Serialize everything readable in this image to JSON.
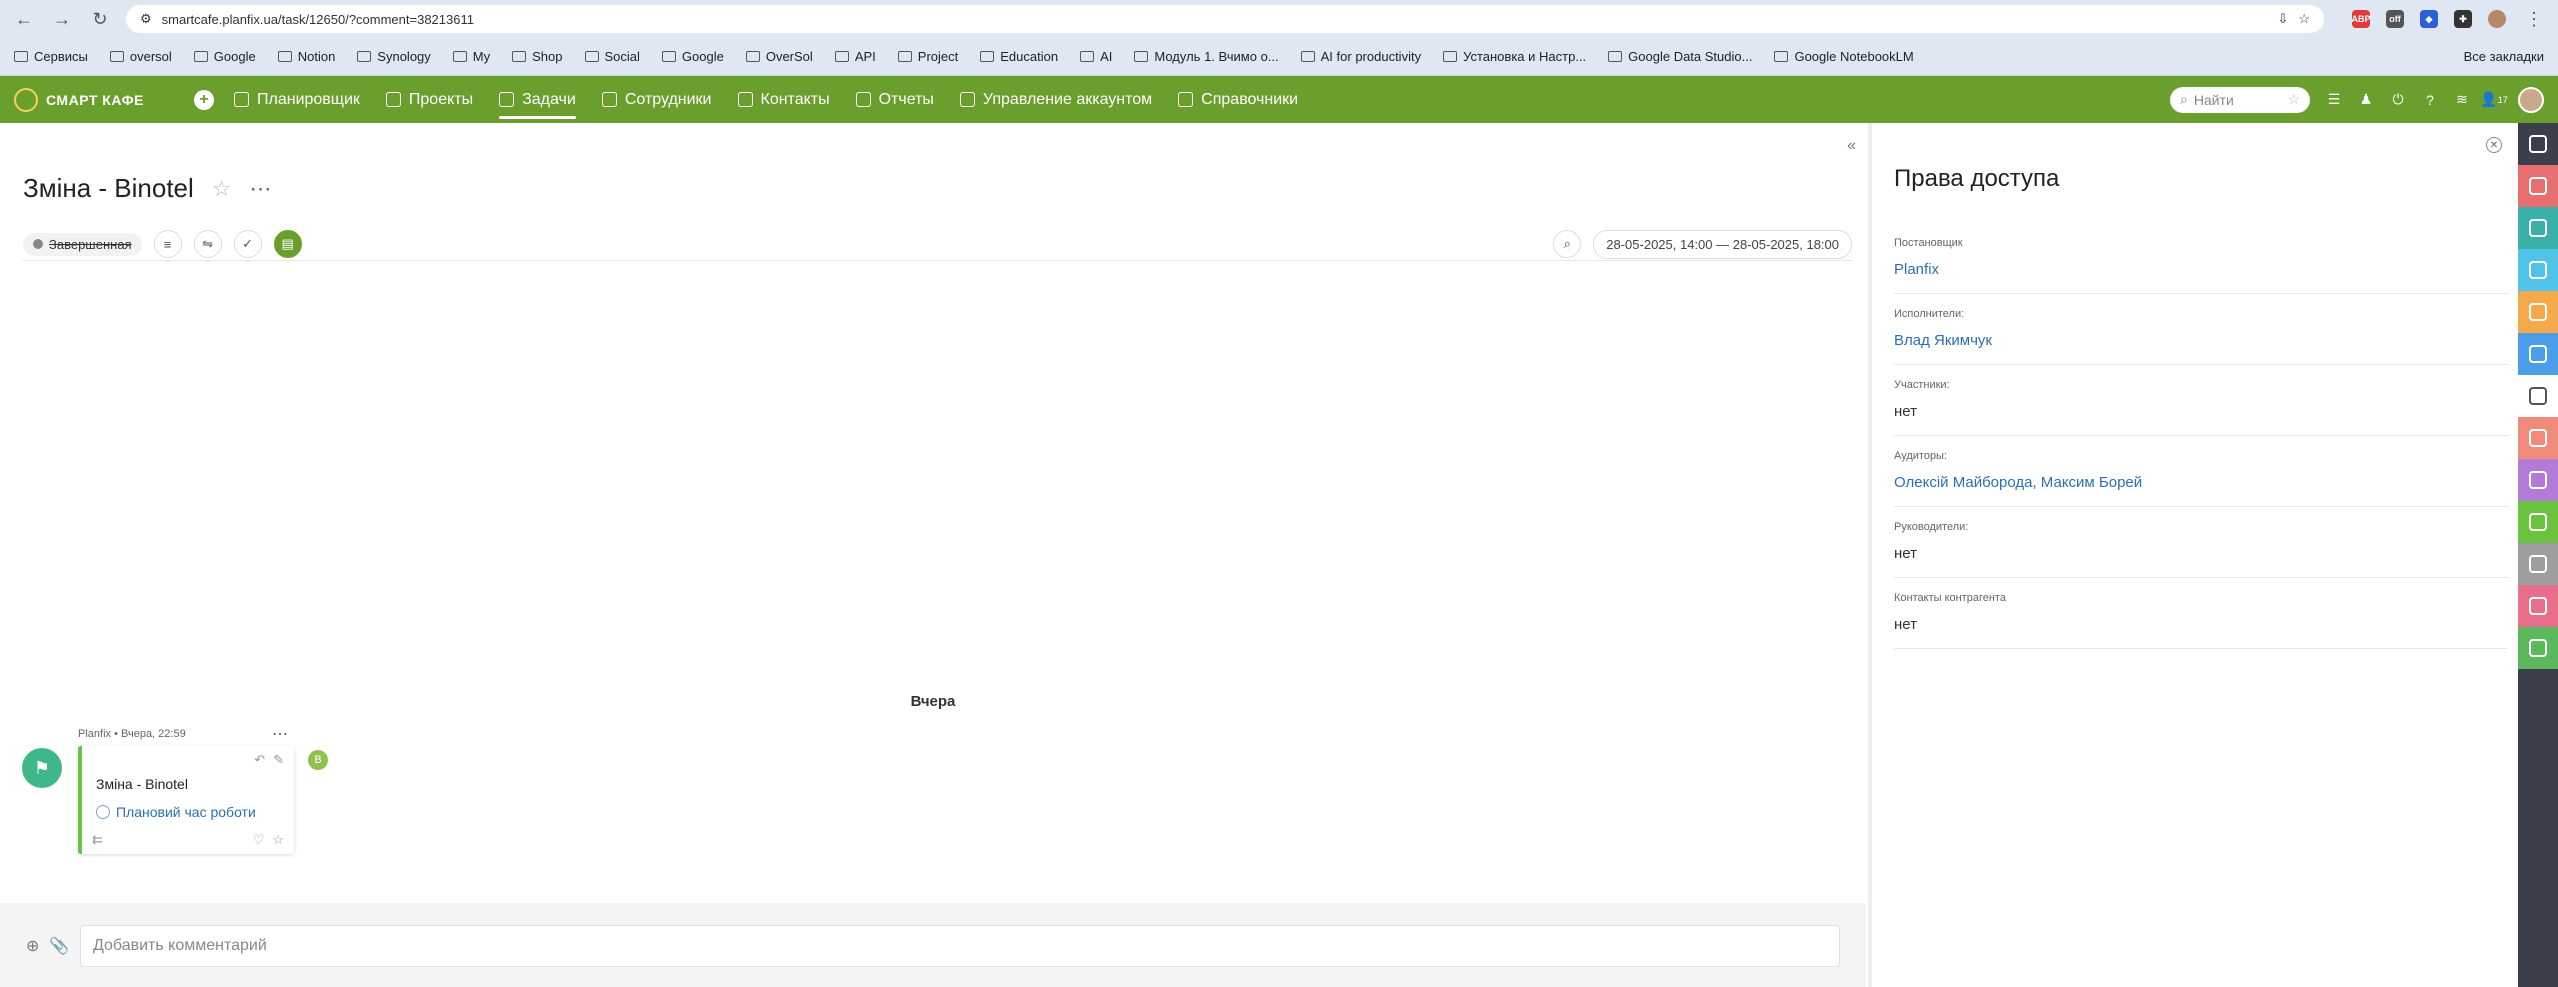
{
  "browser": {
    "url": "smartcafe.planfix.ua/task/12650/?comment=38213611",
    "bookmarks": [
      "Сервисы",
      "oversol",
      "Google",
      "Notion",
      "Synology",
      "My",
      "Shop",
      "Social",
      "Google",
      "OverSol",
      "API",
      "Project",
      "Education",
      "AI",
      "Модуль 1. Вчимо о...",
      "AI for productivity",
      "Установка и Настр...",
      "Google Data Studio...",
      "Google NotebookLM"
    ],
    "bookmarks_right": "Все закладки"
  },
  "app": {
    "logo": "СМАРТ КАФЕ",
    "menu": [
      "Планировщик",
      "Проекты",
      "Задачи",
      "Сотрудники",
      "Контакты",
      "Отчеты",
      "Управление аккаунтом",
      "Справочники"
    ],
    "search_placeholder": "Найти",
    "notif_count": "17"
  },
  "task": {
    "title": "Зміна - Binotel",
    "status": "Завершенная",
    "date_range": "28-05-2025, 14:00 — 28-05-2025, 18:00"
  },
  "feed": {
    "day": "Вчера",
    "comment": {
      "author": "Planfix",
      "time": "Вчера, 22:59",
      "title": "Зміна - Binotel",
      "link": "Плановий час роботи",
      "badge": "В"
    }
  },
  "composer": {
    "placeholder": "Добавить комментарий"
  },
  "rights": {
    "title": "Права доступа",
    "fields": [
      {
        "label": "Постановщик",
        "value": "Planfix",
        "link": true
      },
      {
        "label": "Исполнители:",
        "value": "Влад Якимчук",
        "link": true
      },
      {
        "label": "Участники:",
        "value": "нет",
        "link": false
      },
      {
        "label": "Аудиторы:",
        "value": "Олексій Майборода, Максим Борей",
        "link": true
      },
      {
        "label": "Руководители:",
        "value": "нет",
        "link": false
      },
      {
        "label": "Контакты контрагента",
        "value": "нет",
        "link": false
      }
    ]
  },
  "sidebar_colors": [
    "#3a3f4b",
    "#e86f6f",
    "#3bb0a8",
    "#4fc3e8",
    "#f5a94a",
    "#4a9ee8",
    "#ffffff",
    "#f08a7a",
    "#b37ad6",
    "#6ac23f",
    "#9e9e9e",
    "#e86f8a",
    "#5cb85c"
  ]
}
